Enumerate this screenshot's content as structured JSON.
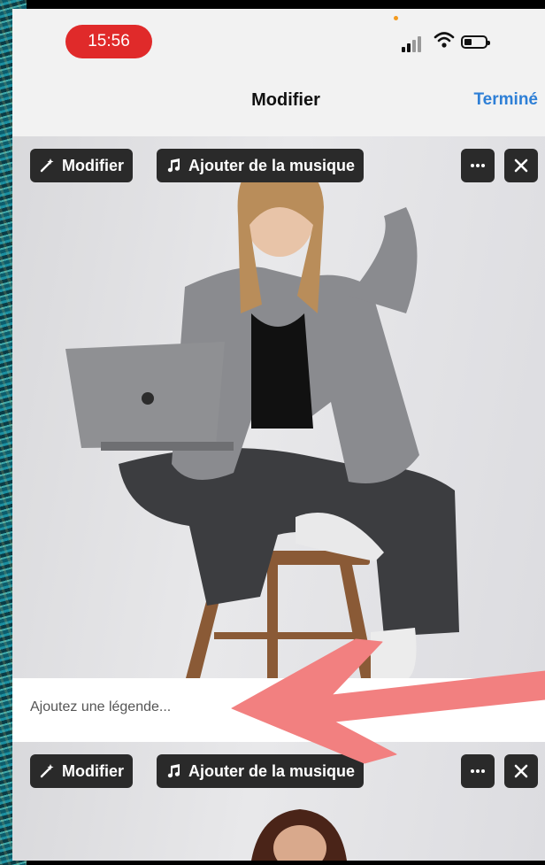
{
  "status_bar": {
    "time": "15:56",
    "icons": [
      "signal-icon",
      "wifi-icon",
      "battery-icon"
    ]
  },
  "nav": {
    "title": "Modifier",
    "done_label": "Terminé"
  },
  "media_items": [
    {
      "edit_label": "Modifier",
      "music_label": "Ajouter de la musique",
      "more_icon": "ellipsis-icon",
      "close_icon": "close-icon",
      "caption_placeholder": "Ajoutez une légende..."
    },
    {
      "edit_label": "Modifier",
      "music_label": "Ajouter de la musique",
      "more_icon": "ellipsis-icon",
      "close_icon": "close-icon"
    }
  ],
  "colors": {
    "time_pill": "#e02a2a",
    "accent": "#2e7fd6",
    "annotation_arrow": "#f28080",
    "pill_bg": "#2a2a2a"
  }
}
